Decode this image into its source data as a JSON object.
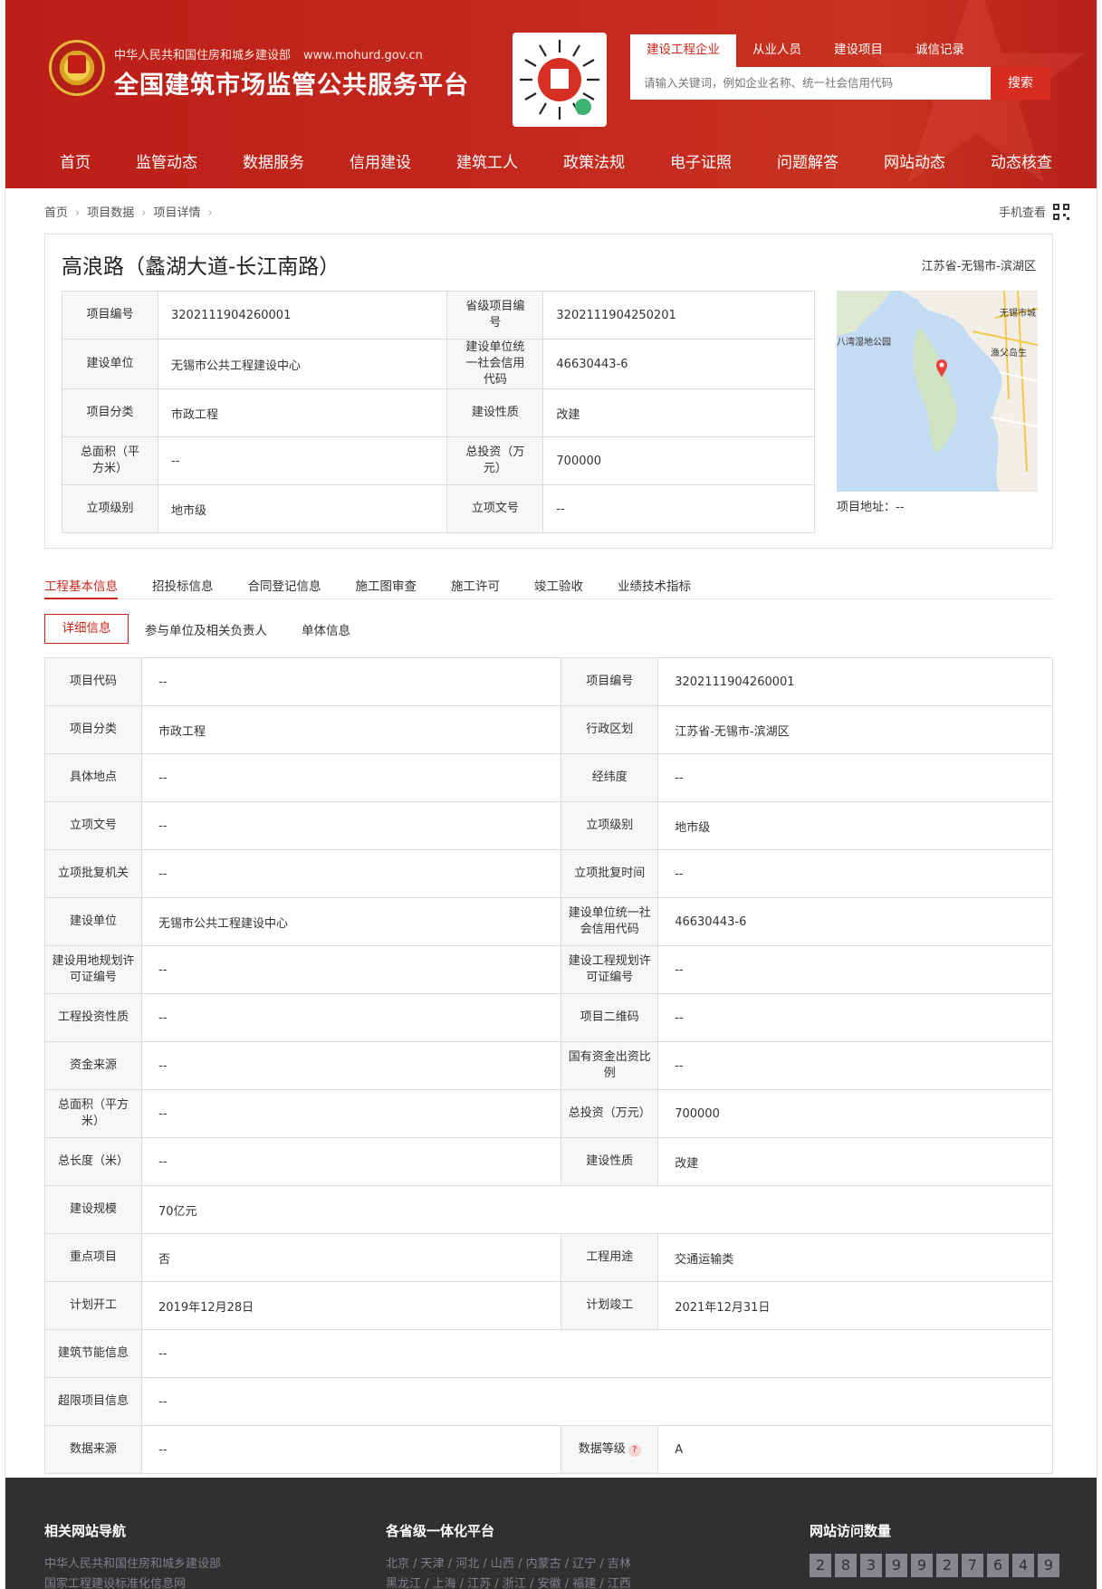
{
  "header": {
    "ministry": "中华人民共和国住房和城乡建设部",
    "url": "www.mohurd.gov.cn",
    "title": "全国建筑市场监管公共服务平台",
    "search_tabs": [
      "建设工程企业",
      "从业人员",
      "建设项目",
      "诚信记录"
    ],
    "search_placeholder": "请输入关键词，例如企业名称、统一社会信用代码",
    "search_button": "搜索",
    "nav": [
      "首页",
      "监管动态",
      "数据服务",
      "信用建设",
      "建筑工人",
      "政策法规",
      "电子证照",
      "问题解答",
      "网站动态",
      "动态核查"
    ]
  },
  "breadcrumb": [
    "首页",
    "项目数据",
    "项目详情"
  ],
  "mobile_view": "手机查看",
  "project": {
    "title": "高浪路（蠡湖大道-长江南路）",
    "region": "江苏省-无锡市-滨湖区",
    "address_label": "项目地址：--",
    "info": [
      [
        "项目编号",
        "3202111904260001",
        "省级项目编号",
        "3202111904250201"
      ],
      [
        "建设单位",
        "无锡市公共工程建设中心",
        "建设单位统一社会信用代码",
        "46630443-6"
      ],
      [
        "项目分类",
        "市政工程",
        "建设性质",
        "改建"
      ],
      [
        "总面积（平方米）",
        "--",
        "总投资（万元）",
        "700000"
      ],
      [
        "立项级别",
        "地市级",
        "立项文号",
        "--"
      ]
    ],
    "map_labels": [
      "无锡市城",
      "八湾湿地公园",
      "渔父岛生"
    ]
  },
  "tabs": [
    "工程基本信息",
    "招投标信息",
    "合同登记信息",
    "施工图审查",
    "施工许可",
    "竣工验收",
    "业绩技术指标"
  ],
  "subtabs": [
    "详细信息",
    "参与单位及相关负责人",
    "单体信息"
  ],
  "detail": [
    [
      "项目代码",
      "--",
      "项目编号",
      "3202111904260001"
    ],
    [
      "项目分类",
      "市政工程",
      "行政区划",
      "江苏省-无锡市-滨湖区"
    ],
    [
      "具体地点",
      "--",
      "经纬度",
      "--"
    ],
    [
      "立项文号",
      "--",
      "立项级别",
      "地市级"
    ],
    [
      "立项批复机关",
      "--",
      "立项批复时间",
      "--"
    ],
    [
      "建设单位",
      "无锡市公共工程建设中心",
      "建设单位统一社会信用代码",
      "46630443-6"
    ],
    [
      "建设用地规划许可证编号",
      "--",
      "建设工程规划许可证编号",
      "--"
    ],
    [
      "工程投资性质",
      "--",
      "项目二维码",
      "--"
    ],
    [
      "资金来源",
      "--",
      "国有资金出资比例",
      "--"
    ],
    [
      "总面积（平方米）",
      "--",
      "总投资（万元）",
      "700000"
    ],
    [
      "总长度（米）",
      "--",
      "建设性质",
      "改建"
    ],
    [
      "建设规模",
      "70亿元"
    ],
    [
      "重点项目",
      "否",
      "工程用途",
      "交通运输类"
    ],
    [
      "计划开工",
      "2019年12月28日",
      "计划竣工",
      "2021年12月31日"
    ],
    [
      "建筑节能信息",
      "--"
    ],
    [
      "超限项目信息",
      "--"
    ],
    [
      "数据来源",
      "--",
      "数据等级",
      "A"
    ]
  ],
  "help_mark": "?",
  "footer": {
    "nav_title": "相关网站导航",
    "nav_links": [
      "中华人民共和国住房和城乡建设部",
      "国家工程建设标准化信息网"
    ],
    "prov_title": "各省级一体化平台",
    "prov_line1": "北京 / 天津 / 河北 / 山西 / 内蒙古 / 辽宁 / 吉林",
    "prov_line2": "黑龙江 / 上海 / 江苏 / 浙江 / 安徽 / 福建 / 江西",
    "visit_title": "网站访问数量",
    "visit_digits": [
      "2",
      "8",
      "3",
      "9",
      "9",
      "2",
      "7",
      "6",
      "4",
      "9"
    ]
  }
}
